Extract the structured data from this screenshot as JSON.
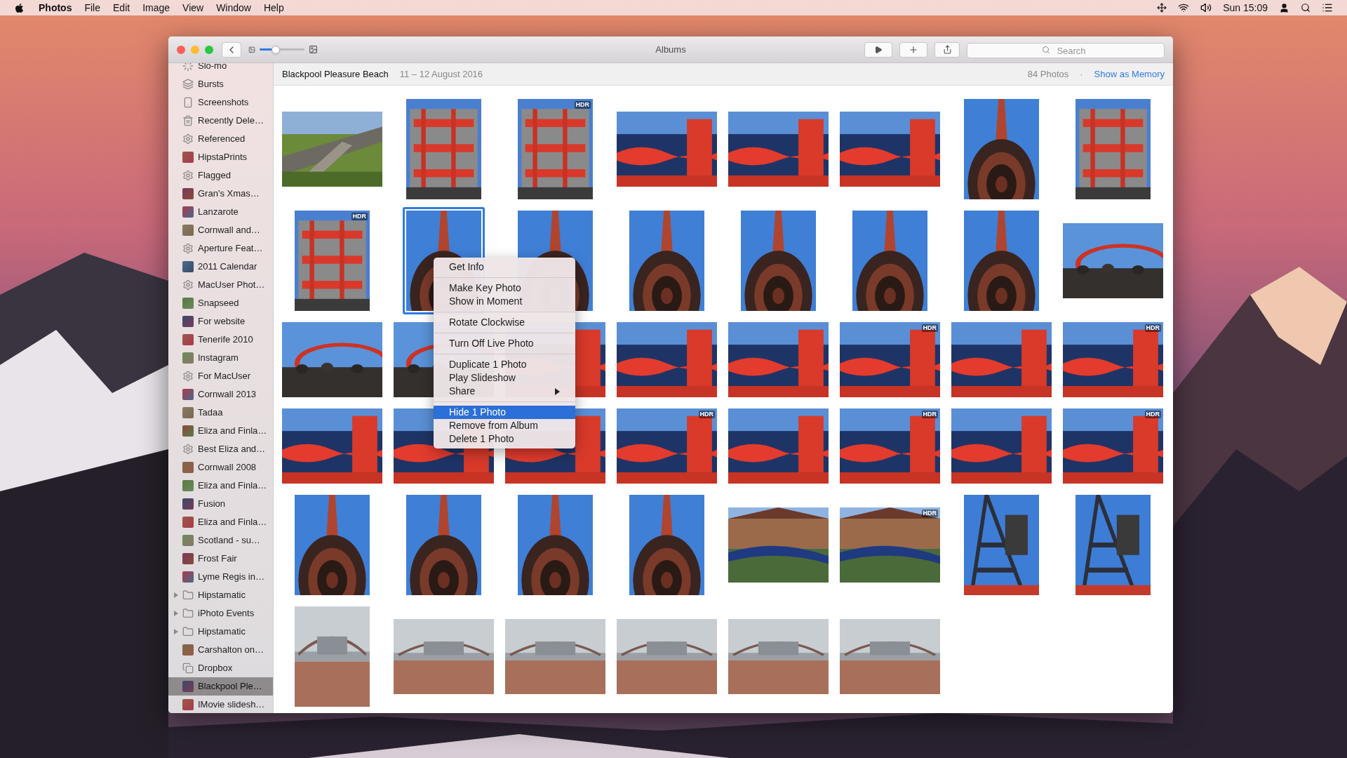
{
  "menu_bar": {
    "app": "Photos",
    "menus": [
      "File",
      "Edit",
      "Image",
      "View",
      "Window",
      "Help"
    ],
    "clock": "Sun 15:09"
  },
  "window": {
    "title": "Albums",
    "zoom_slider": {
      "level": 0.36
    },
    "search": {
      "placeholder": "Search"
    }
  },
  "sidebar": {
    "items": [
      {
        "kind": "slomo",
        "label": "Slo-mo",
        "selected": false
      },
      {
        "kind": "bursts",
        "label": "Bursts",
        "selected": false
      },
      {
        "kind": "screenshots",
        "label": "Screenshots",
        "selected": false
      },
      {
        "kind": "trash",
        "label": "Recently Dele…",
        "selected": false
      },
      {
        "kind": "smart",
        "label": "Referenced",
        "selected": false
      },
      {
        "kind": "album",
        "label": "HipstaPrints",
        "selected": false
      },
      {
        "kind": "smart",
        "label": "Flagged",
        "selected": false
      },
      {
        "kind": "album",
        "label": "Gran's Xmas…",
        "selected": false
      },
      {
        "kind": "album",
        "label": "Lanzarote",
        "selected": false
      },
      {
        "kind": "album",
        "label": "Cornwall and…",
        "selected": false
      },
      {
        "kind": "smart",
        "label": "Aperture Feat…",
        "selected": false
      },
      {
        "kind": "album",
        "label": "2011 Calendar",
        "selected": false
      },
      {
        "kind": "smart",
        "label": "MacUser Phot…",
        "selected": false
      },
      {
        "kind": "album",
        "label": "Snapseed",
        "selected": false
      },
      {
        "kind": "album",
        "label": "For website",
        "selected": false
      },
      {
        "kind": "album",
        "label": "Tenerife 2010",
        "selected": false
      },
      {
        "kind": "album",
        "label": "Instagram",
        "selected": false
      },
      {
        "kind": "smart",
        "label": "For MacUser",
        "selected": false
      },
      {
        "kind": "album",
        "label": "Cornwall 2013",
        "selected": false
      },
      {
        "kind": "album",
        "label": "Tadaa",
        "selected": false
      },
      {
        "kind": "album",
        "label": "Eliza and Finla…",
        "selected": false
      },
      {
        "kind": "smart",
        "label": "Best Eliza and…",
        "selected": false
      },
      {
        "kind": "album",
        "label": "Cornwall 2008",
        "selected": false
      },
      {
        "kind": "album",
        "label": "Eliza and Finla…",
        "selected": false
      },
      {
        "kind": "album",
        "label": "Fusion",
        "selected": false
      },
      {
        "kind": "album",
        "label": "Eliza and Finla…",
        "selected": false
      },
      {
        "kind": "album",
        "label": "Scotland - su…",
        "selected": false
      },
      {
        "kind": "album",
        "label": "Frost Fair",
        "selected": false
      },
      {
        "kind": "album",
        "label": "Lyme Regis in…",
        "selected": false
      },
      {
        "kind": "folder",
        "label": "Hipstamatic",
        "selected": false,
        "expanded": false
      },
      {
        "kind": "folder",
        "label": "iPhoto Events",
        "selected": false,
        "expanded": false
      },
      {
        "kind": "folder",
        "label": "Hipstamatic",
        "selected": false,
        "expanded": false
      },
      {
        "kind": "album",
        "label": "Carshalton on…",
        "selected": false
      },
      {
        "kind": "shared",
        "label": "Dropbox",
        "selected": false
      },
      {
        "kind": "album",
        "label": "Blackpool Ple…",
        "selected": true
      },
      {
        "kind": "album",
        "label": "IMovie slidesh…",
        "selected": false
      }
    ]
  },
  "header": {
    "title": "Blackpool Pleasure Beach",
    "dates": "11 – 12 August 2016",
    "count": "84 Photos",
    "separator": "·",
    "link": "Show as Memory"
  },
  "grid": {
    "rows": [
      {
        "photos": [
          {
            "kind": "landscape",
            "selected": false
          },
          {
            "kind": "portrait",
            "selected": false
          },
          {
            "kind": "portrait",
            "selected": false,
            "badge": "HDR"
          },
          {
            "kind": "landscape",
            "selected": false
          },
          {
            "kind": "landscape",
            "selected": false
          },
          {
            "kind": "landscape",
            "selected": false
          },
          {
            "kind": "portrait",
            "selected": false
          },
          {
            "kind": "portrait",
            "selected": false
          }
        ]
      },
      {
        "photos": [
          {
            "kind": "portrait",
            "selected": false,
            "badge": "HDR"
          },
          {
            "kind": "portrait",
            "selected": true
          },
          {
            "kind": "portrait",
            "selected": false
          },
          {
            "kind": "portrait",
            "selected": false
          },
          {
            "kind": "portrait",
            "selected": false
          },
          {
            "kind": "portrait",
            "selected": false
          },
          {
            "kind": "portrait",
            "selected": false
          },
          {
            "kind": "landscape",
            "selected": false
          }
        ]
      },
      {
        "photos": [
          {
            "kind": "landscape",
            "selected": false
          },
          {
            "kind": "landscape",
            "selected": false
          },
          {
            "kind": "landscape",
            "selected": false
          },
          {
            "kind": "landscape",
            "selected": false
          },
          {
            "kind": "landscape",
            "selected": false
          },
          {
            "kind": "landscape",
            "selected": false,
            "badge": "HDR"
          },
          {
            "kind": "landscape",
            "selected": false
          },
          {
            "kind": "landscape",
            "selected": false,
            "badge": "HDR"
          }
        ]
      },
      {
        "photos": [
          {
            "kind": "landscape",
            "selected": false
          },
          {
            "kind": "landscape",
            "selected": false
          },
          {
            "kind": "landscape",
            "selected": false
          },
          {
            "kind": "landscape",
            "selected": false,
            "badge": "HDR"
          },
          {
            "kind": "landscape",
            "selected": false
          },
          {
            "kind": "landscape",
            "selected": false,
            "badge": "HDR"
          },
          {
            "kind": "landscape",
            "selected": false
          },
          {
            "kind": "landscape",
            "selected": false,
            "badge": "HDR"
          }
        ]
      },
      {
        "photos": [
          {
            "kind": "portrait",
            "selected": false
          },
          {
            "kind": "portrait",
            "selected": false
          },
          {
            "kind": "portrait",
            "selected": false
          },
          {
            "kind": "portrait",
            "selected": false
          },
          {
            "kind": "landscape",
            "selected": false
          },
          {
            "kind": "landscape",
            "selected": false,
            "badge": "HDR"
          },
          {
            "kind": "portrait",
            "selected": false
          },
          {
            "kind": "portrait",
            "selected": false
          }
        ]
      },
      {
        "photos": [
          {
            "kind": "portrait",
            "selected": false
          },
          {
            "kind": "landscape",
            "selected": false
          },
          {
            "kind": "landscape",
            "selected": false
          },
          {
            "kind": "landscape",
            "selected": false
          },
          {
            "kind": "landscape",
            "selected": false
          },
          {
            "kind": "landscape",
            "selected": false
          }
        ]
      }
    ]
  },
  "context_menu": {
    "groups": [
      {
        "items": [
          {
            "label": "Get Info",
            "selected": false
          }
        ]
      },
      {
        "items": [
          {
            "label": "Make Key Photo",
            "selected": false
          },
          {
            "label": "Show in Moment",
            "selected": false
          }
        ]
      },
      {
        "items": [
          {
            "label": "Rotate Clockwise",
            "selected": false
          }
        ]
      },
      {
        "items": [
          {
            "label": "Turn Off Live Photo",
            "selected": false
          }
        ]
      },
      {
        "items": [
          {
            "label": "Duplicate 1 Photo",
            "selected": false
          },
          {
            "label": "Play Slideshow",
            "selected": false
          },
          {
            "label": "Share",
            "selected": false,
            "submenu": true
          }
        ]
      },
      {
        "items": [
          {
            "label": "Hide 1 Photo",
            "selected": true
          },
          {
            "label": "Remove from Album",
            "selected": false
          },
          {
            "label": "Delete 1 Photo",
            "selected": false
          }
        ]
      }
    ]
  }
}
